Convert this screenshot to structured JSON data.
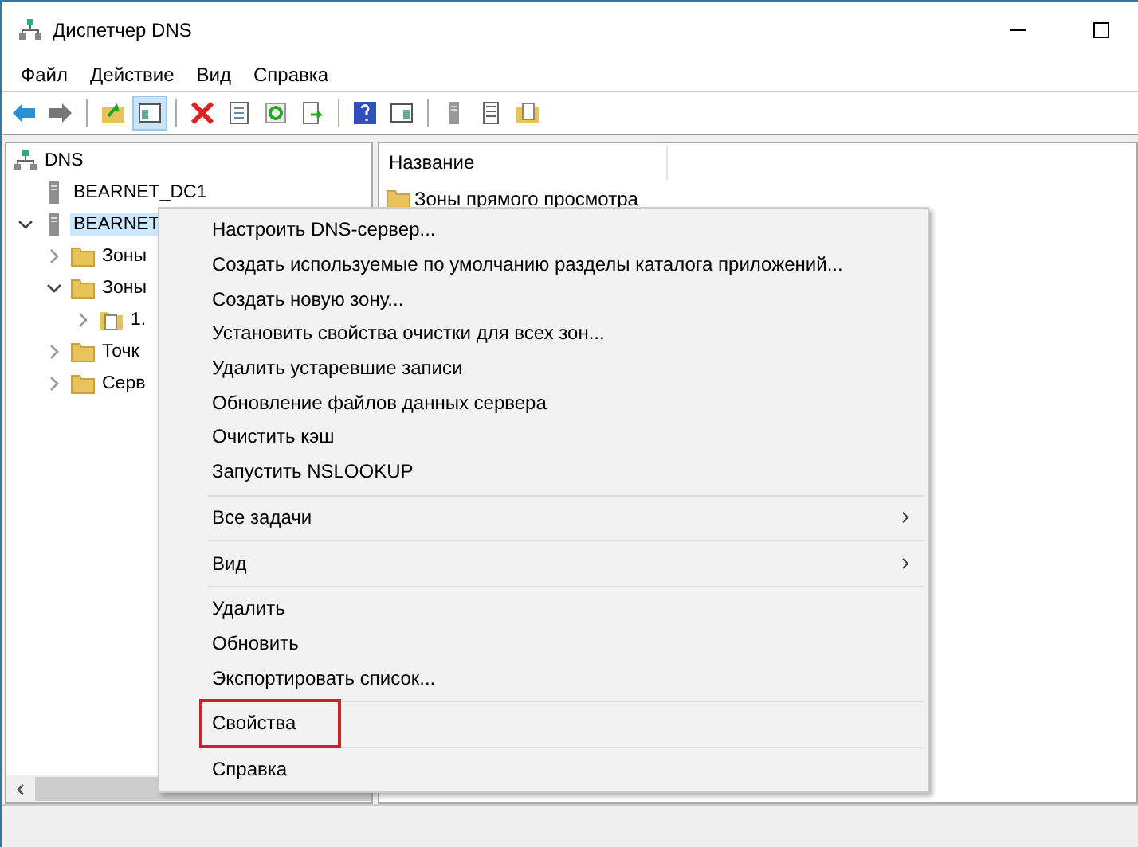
{
  "window": {
    "title": "Диспетчер DNS"
  },
  "menu_bar": [
    "Файл",
    "Действие",
    "Вид",
    "Справка"
  ],
  "tree": [
    {
      "label": "DNS",
      "kind": "dns",
      "selected": false,
      "children": [
        {
          "label": "BEARNET_DC1",
          "kind": "server",
          "selected": false
        },
        {
          "label": "BEARNET",
          "kind": "server",
          "expanded": true,
          "selected": true,
          "children": [
            {
              "label": "Зоны",
              "kind": "folder",
              "expanded": false,
              "selected": false
            },
            {
              "label": "Зоны",
              "kind": "folder",
              "expanded": true,
              "selected": false,
              "children": [
                {
                  "label": "1.",
                  "kind": "zone",
                  "expanded": false,
                  "selected": false
                }
              ]
            },
            {
              "label": "Точк",
              "kind": "folder",
              "expanded": false,
              "selected": false
            },
            {
              "label": "Серв",
              "kind": "folder",
              "expanded": false,
              "selected": false
            }
          ]
        }
      ]
    }
  ],
  "list": {
    "columns": [
      "Название"
    ],
    "rows": [
      "Зоны прямого просмотра"
    ]
  },
  "context_menu": [
    {
      "kind": "item",
      "label": "Настроить DNS-сервер...",
      "annotated": false
    },
    {
      "kind": "item",
      "label": "Создать используемые по умолчанию разделы каталога приложений...",
      "annotated": false
    },
    {
      "kind": "item",
      "label": "Создать новую зону...",
      "annotated": false
    },
    {
      "kind": "item",
      "label": "Установить свойства очистки для всех зон...",
      "annotated": false
    },
    {
      "kind": "item",
      "label": "Удалить устаревшие записи",
      "annotated": false
    },
    {
      "kind": "item",
      "label": "Обновление файлов данных сервера",
      "annotated": false
    },
    {
      "kind": "item",
      "label": "Очистить кэш",
      "annotated": false
    },
    {
      "kind": "item",
      "label": "Запустить NSLOOKUP",
      "annotated": false
    },
    {
      "kind": "separator"
    },
    {
      "kind": "submenu",
      "label": "Все задачи",
      "annotated": false
    },
    {
      "kind": "separator"
    },
    {
      "kind": "submenu",
      "label": "Вид",
      "annotated": false
    },
    {
      "kind": "separator"
    },
    {
      "kind": "item",
      "label": "Удалить",
      "annotated": false
    },
    {
      "kind": "item",
      "label": "Обновить",
      "annotated": false
    },
    {
      "kind": "item",
      "label": "Экспортировать список...",
      "annotated": false
    },
    {
      "kind": "separator"
    },
    {
      "kind": "item",
      "label": "Свойства",
      "annotated": true
    },
    {
      "kind": "separator"
    },
    {
      "kind": "item",
      "label": "Справка",
      "annotated": false
    }
  ]
}
